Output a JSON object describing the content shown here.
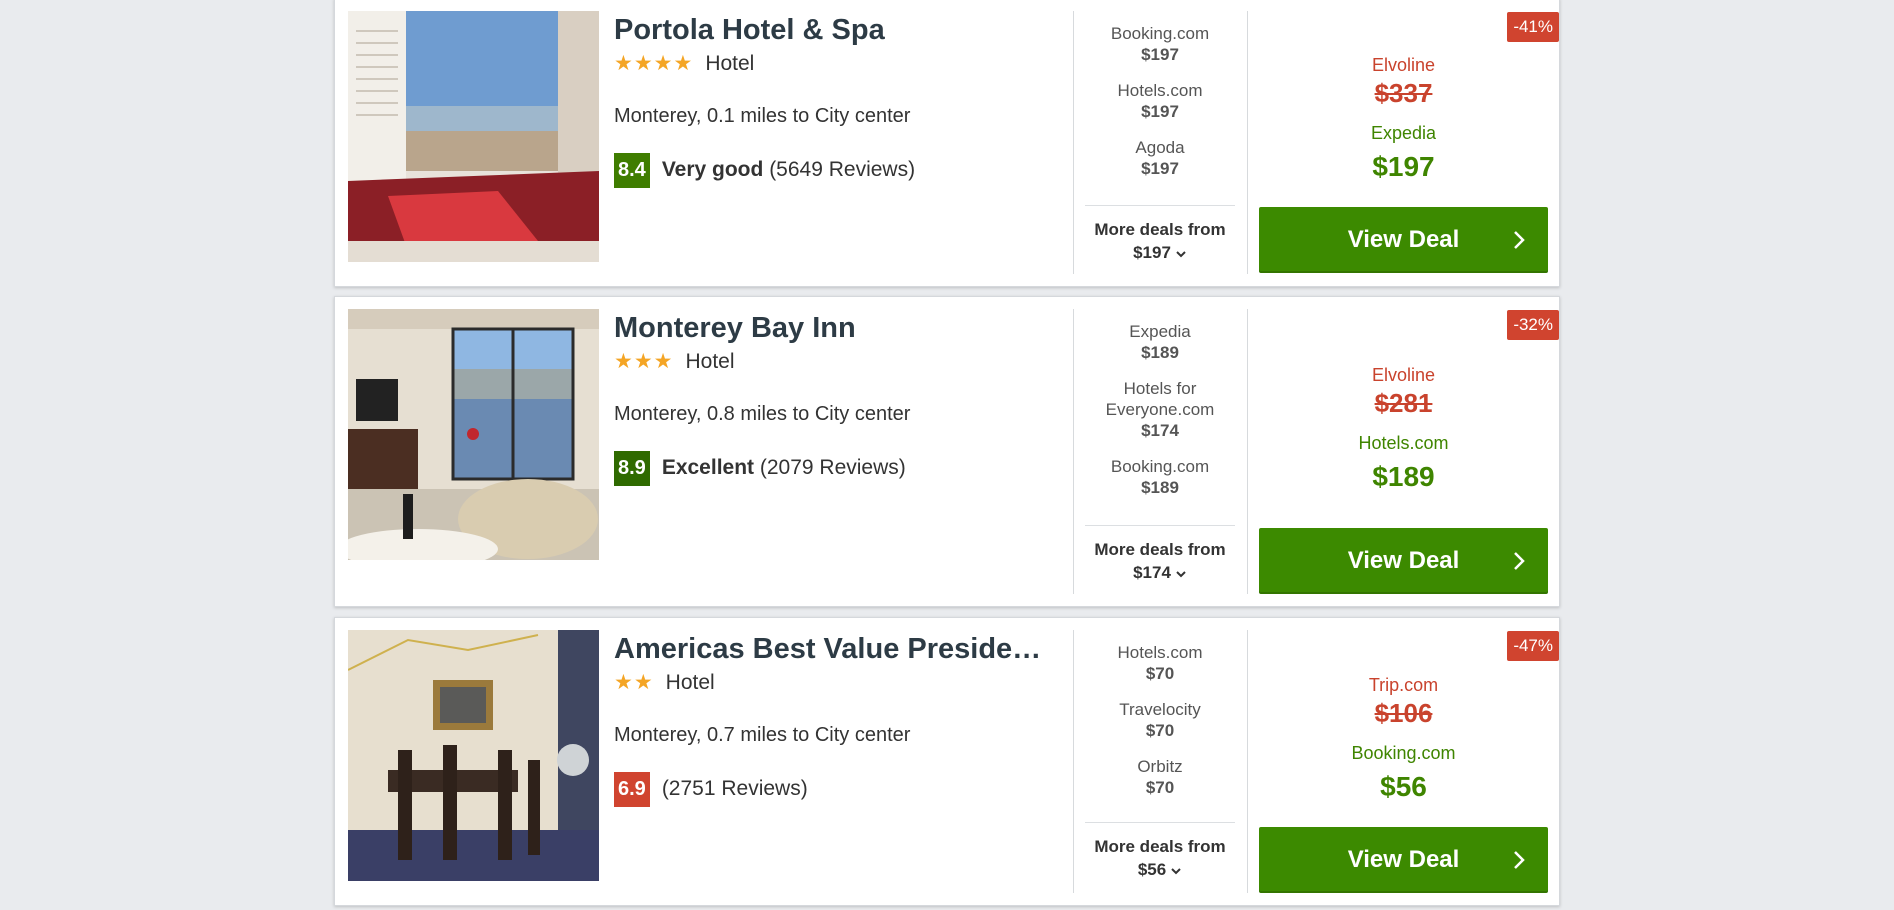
{
  "hotels": [
    {
      "name": "Portola Hotel & Spa",
      "stars": "★★★★",
      "type": "Hotel",
      "location": "Monterey, 0.1 miles to City center",
      "score": "8.4",
      "score_color": "#3f7d00",
      "rating_label": "Very good",
      "reviews": "(5649 Reviews)",
      "providers": [
        {
          "name": "Booking.com",
          "price": "$197"
        },
        {
          "name": "Hotels.com",
          "price": "$197"
        },
        {
          "name": "Agoda",
          "price": "$197"
        }
      ],
      "more_label": "More deals from",
      "more_price": "$197",
      "discount": "-41%",
      "original_site": "Elvoline",
      "original_price": "$337",
      "best_site": "Expedia",
      "best_price": "$197",
      "button": "View Deal"
    },
    {
      "name": "Monterey Bay Inn",
      "stars": "★★★",
      "type": "Hotel",
      "location": "Monterey, 0.8 miles to City center",
      "score": "8.9",
      "score_color": "#2f6a00",
      "rating_label": "Excellent",
      "reviews": "(2079 Reviews)",
      "providers": [
        {
          "name": "Expedia",
          "price": "$189"
        },
        {
          "name": "Hotels for Everyone.com",
          "price": "$174"
        },
        {
          "name": "Booking.com",
          "price": "$189"
        }
      ],
      "more_label": "More deals from",
      "more_price": "$174",
      "discount": "-32%",
      "original_site": "Elvoline",
      "original_price": "$281",
      "best_site": "Hotels.com",
      "best_price": "$189",
      "button": "View Deal"
    },
    {
      "name": "Americas Best Value Preside…",
      "stars": "★★",
      "type": "Hotel",
      "location": "Monterey, 0.7 miles to City center",
      "score": "6.9",
      "score_color": "#d0442f",
      "rating_label": "",
      "reviews": "(2751 Reviews)",
      "providers": [
        {
          "name": "Hotels.com",
          "price": "$70"
        },
        {
          "name": "Travelocity",
          "price": "$70"
        },
        {
          "name": "Orbitz",
          "price": "$70"
        }
      ],
      "more_label": "More deals from",
      "more_price": "$56",
      "discount": "-47%",
      "original_site": "Trip.com",
      "original_price": "$106",
      "best_site": "Booking.com",
      "best_price": "$56",
      "button": "View Deal"
    }
  ]
}
